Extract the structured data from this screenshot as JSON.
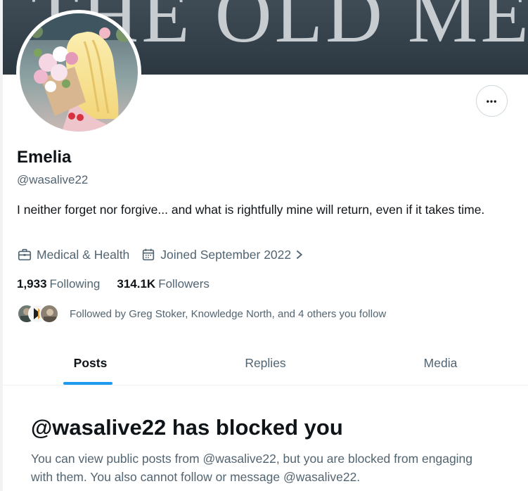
{
  "banner": {
    "text": "THE OLD ME."
  },
  "profile": {
    "name": "Emelia",
    "handle": "@wasalive22",
    "bio": "I neither forget nor forgive... and what is rightfully mine will return, even if it takes time.",
    "category": "Medical & Health",
    "joined": "Joined September 2022",
    "following_count": "1,933",
    "following_label": "Following",
    "followers_count": "314.1K",
    "followers_label": "Followers",
    "followed_by": "Followed by Greg Stoker, Knowledge North, and 4 others you follow"
  },
  "actions": {
    "more": "•••"
  },
  "tabs": [
    {
      "label": "Posts",
      "active": true
    },
    {
      "label": "Replies",
      "active": false
    },
    {
      "label": "Media",
      "active": false
    }
  ],
  "blocked": {
    "title": "@wasalive22 has blocked you",
    "body": "You can view public posts from @wasalive22, but you are blocked from engaging with them. You also cannot follow or message @wasalive22."
  },
  "colors": {
    "accent": "#1d9bf0",
    "text_primary": "#0f1419",
    "text_secondary": "#536471",
    "banner": "#3a4650"
  },
  "icons": [
    "briefcase-icon",
    "calendar-icon",
    "chevron-right-icon",
    "more-icon"
  ]
}
